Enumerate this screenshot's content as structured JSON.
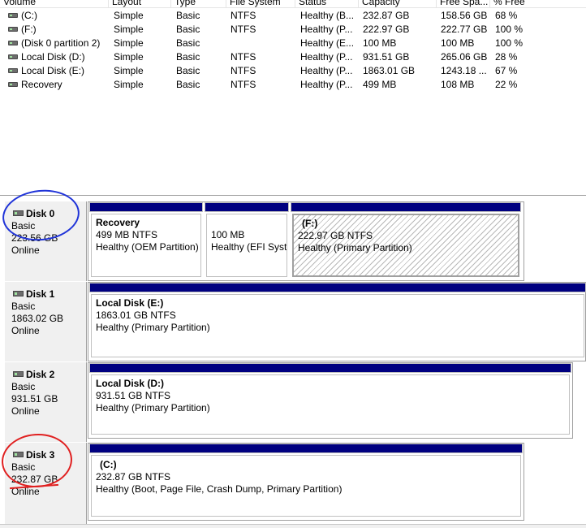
{
  "volume_list": {
    "columns": [
      "Volume",
      "Layout",
      "Type",
      "File System",
      "Status",
      "Capacity",
      "Free Spa...",
      "% Free"
    ],
    "rows": [
      {
        "volume": "(C:)",
        "layout": "Simple",
        "type": "Basic",
        "fs": "NTFS",
        "status": "Healthy (B...",
        "capacity": "232.87 GB",
        "free": "158.56 GB",
        "pct": "68 %"
      },
      {
        "volume": "(F:)",
        "layout": "Simple",
        "type": "Basic",
        "fs": "NTFS",
        "status": "Healthy (P...",
        "capacity": "222.97 GB",
        "free": "222.77 GB",
        "pct": "100 %"
      },
      {
        "volume": "(Disk 0 partition 2)",
        "layout": "Simple",
        "type": "Basic",
        "fs": "",
        "status": "Healthy (E...",
        "capacity": "100 MB",
        "free": "100 MB",
        "pct": "100 %"
      },
      {
        "volume": "Local Disk (D:)",
        "layout": "Simple",
        "type": "Basic",
        "fs": "NTFS",
        "status": "Healthy (P...",
        "capacity": "931.51 GB",
        "free": "265.06 GB",
        "pct": "28 %"
      },
      {
        "volume": "Local Disk (E:)",
        "layout": "Simple",
        "type": "Basic",
        "fs": "NTFS",
        "status": "Healthy (P...",
        "capacity": "1863.01 GB",
        "free": "1243.18 ...",
        "pct": "67 %"
      },
      {
        "volume": "Recovery",
        "layout": "Simple",
        "type": "Basic",
        "fs": "NTFS",
        "status": "Healthy (P...",
        "capacity": "499 MB",
        "free": "108 MB",
        "pct": "22 %"
      }
    ]
  },
  "disks": [
    {
      "name": "Disk 0",
      "type": "Basic",
      "size": "223.56 GB",
      "status": "Online",
      "partitions": [
        {
          "title": "Recovery",
          "size": "499 MB NTFS",
          "status": "Healthy (OEM Partition)"
        },
        {
          "title": "",
          "size": "100 MB",
          "status": "Healthy (EFI System Partition)"
        },
        {
          "title": "(F:)",
          "size": "222.97 GB NTFS",
          "status": "Healthy (Primary Partition)"
        }
      ]
    },
    {
      "name": "Disk 1",
      "type": "Basic",
      "size": "1863.02 GB",
      "status": "Online",
      "partitions": [
        {
          "title": "Local Disk  (E:)",
          "size": "1863.01 GB NTFS",
          "status": "Healthy (Primary Partition)"
        }
      ]
    },
    {
      "name": "Disk 2",
      "type": "Basic",
      "size": "931.51 GB",
      "status": "Online",
      "partitions": [
        {
          "title": "Local Disk  (D:)",
          "size": "931.51 GB NTFS",
          "status": "Healthy (Primary Partition)"
        }
      ]
    },
    {
      "name": "Disk 3",
      "type": "Basic",
      "size": "232.87 GB",
      "status": "Online",
      "partitions": [
        {
          "title": "(C:)",
          "size": "232.87 GB NTFS",
          "status": "Healthy (Boot, Page File, Crash Dump, Primary Partition)"
        }
      ]
    }
  ],
  "colors": {
    "partition_stripe": "#000080",
    "annotation_blue": "#1f33d8",
    "annotation_red": "#e02020"
  }
}
